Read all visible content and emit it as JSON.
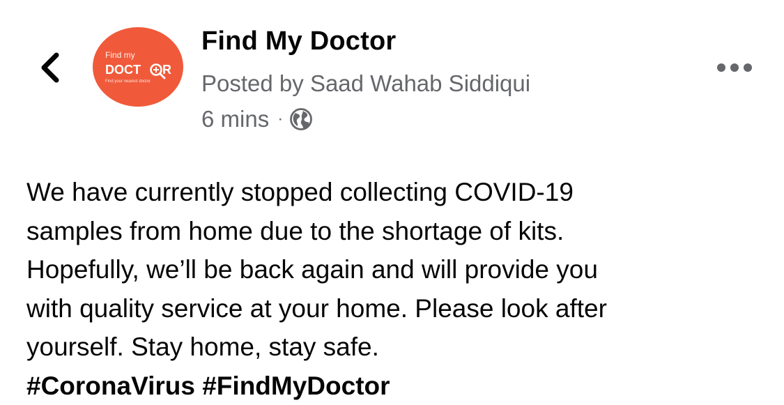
{
  "post": {
    "page_name": "Find My Doctor",
    "posted_by_prefix": "Posted by",
    "author": "Saad Wahab Siddiqui",
    "time": "6 mins",
    "separator": "·",
    "body_lines": [
      "We have currently stopped collecting COVID-19",
      "samples from home due to the shortage of kits.",
      "Hopefully, we’ll be back again and will provide you",
      "with quality service at your home. Please look after",
      "yourself. Stay home, stay safe."
    ],
    "hashtags": [
      "#CoronaVirus",
      "#FindMyDoctor"
    ]
  },
  "avatar_logo": {
    "line1": "Find my",
    "line2_left": "DOCT",
    "line2_right": "R",
    "tagline": "Find your nearest doctor",
    "background": "#f05a3a"
  },
  "icons": {
    "back": "chevron-left-icon",
    "globe": "globe-icon",
    "more": "more-dots-icon"
  },
  "colors": {
    "text_primary": "#050505",
    "text_secondary": "#65676b",
    "avatar_bg": "#f05a3a"
  }
}
